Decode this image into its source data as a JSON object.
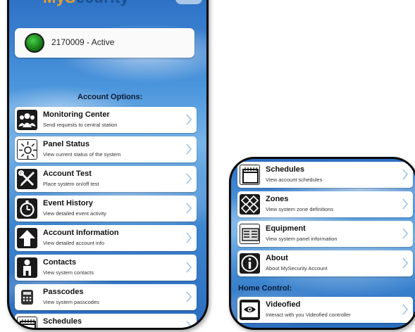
{
  "header": {
    "brand_first": "MyS",
    "brand_rest": "ecurity"
  },
  "account": {
    "status": "2170009 - Active",
    "status_color": "#1f9a1f"
  },
  "left": {
    "section_title": "Account Options:",
    "items": [
      {
        "title": "Monitoring Center",
        "subtitle": "Send requests to central station",
        "icon": "people-icon"
      },
      {
        "title": "Panel Status",
        "subtitle": "View current status of the system",
        "icon": "sun-icon"
      },
      {
        "title": "Account Test",
        "subtitle": "Place system on/off test",
        "icon": "tools-icon"
      },
      {
        "title": "Event History",
        "subtitle": "View detailed event activity",
        "icon": "stopwatch-icon"
      },
      {
        "title": "Account Information",
        "subtitle": "View detailed account info",
        "icon": "arrow-up-icon"
      },
      {
        "title": "Contacts",
        "subtitle": "View system contacts",
        "icon": "person-icon"
      },
      {
        "title": "Passcodes",
        "subtitle": "View system passcodes",
        "icon": "keypad-icon"
      },
      {
        "title": "Schedules",
        "subtitle": "",
        "icon": "calendar-icon"
      }
    ]
  },
  "right": {
    "items": [
      {
        "title": "Schedules",
        "subtitle": "View account schedules",
        "icon": "calendar-icon"
      },
      {
        "title": "Zones",
        "subtitle": "View system zone definitions",
        "icon": "zones-icon"
      },
      {
        "title": "Equipment",
        "subtitle": "View system panel information",
        "icon": "equipment-icon"
      },
      {
        "title": "About",
        "subtitle": "About MySecurity Account",
        "icon": "info-icon"
      }
    ],
    "home_control_title": "Home Control:",
    "home_items": [
      {
        "title": "Videofied",
        "subtitle": "Interact with you Videofied controller",
        "icon": "camera-icon"
      }
    ]
  }
}
